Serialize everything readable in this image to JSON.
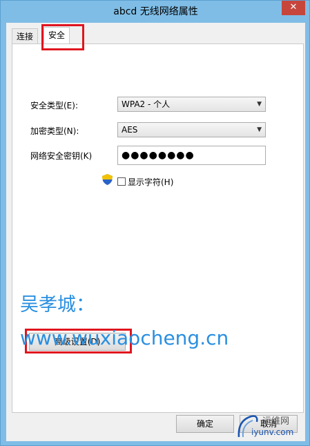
{
  "window": {
    "title": "abcd 无线网络属性",
    "close_glyph": "✕"
  },
  "tabs": [
    {
      "label": "连接"
    },
    {
      "label": "安全"
    }
  ],
  "security_type": {
    "label": "安全类型(E):",
    "value": "WPA2 - 个人"
  },
  "encryption_type": {
    "label": "加密类型(N):",
    "value": "AES"
  },
  "network_key": {
    "label": "网络安全密钥(K)",
    "value": "●●●●●●●●"
  },
  "show_chars": {
    "label": "显示字符(H)",
    "checked": false
  },
  "advanced_button": {
    "label": "高级设置(D)"
  },
  "footer": {
    "ok_label": "确定",
    "cancel_label": "取消"
  },
  "watermark": {
    "name": "吴孝城：",
    "url": "www.wuxiaocheng.cn"
  },
  "corner_logo": {
    "line1": "运维网",
    "line2": "iyunv.com"
  },
  "colors": {
    "highlight": "#e0141e",
    "watermark": "#2a8fe0",
    "title_bg": "#7fbde6"
  }
}
